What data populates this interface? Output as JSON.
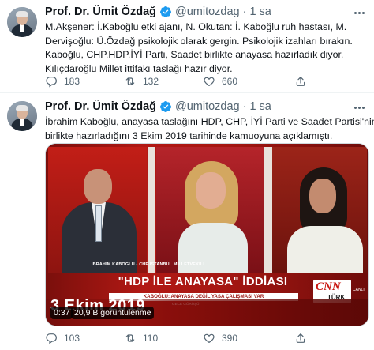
{
  "tweets": [
    {
      "author_name": "Prof. Dr. Ümit Özdağ",
      "handle": "@umitozdag",
      "separator": "·",
      "time": "1 sa",
      "text_lines": [
        "M.Akşener: İ.Kaboğlu etki ajanı, N. Okutan: İ. Kaboğlu ruh hastası, M.",
        "Dervişoğlu: Ü.Özdağ psikolojik olarak gergin. Psikolojik izahları bırakın.",
        "Kaboğlu, CHP,HDP,İYİ Parti, Saadet birlikte anayasa hazırladık diyor.",
        "Kılıçdaroğlu Millet ittifakı taslağı hazır diyor."
      ],
      "replies": "183",
      "retweets": "132",
      "likes": "660"
    },
    {
      "author_name": "Prof. Dr. Ümit Özdağ",
      "handle": "@umitozdag",
      "separator": "·",
      "time": "1 sa",
      "text_lines": [
        "İbrahim Kaboğlu, anayasa taslağını HDP, CHP, İYİ Parti ve Saadet Partisi'nin",
        "birlikte hazırladığını 3 Ekim 2019 tarihinde kamuoyuna açıklamıştı."
      ],
      "video": {
        "lower_third_name": "İBRAHİM KABOĞLU - CHP İSTANBUL MİLLETVEKİLİ",
        "headline": "\"HDP İLE ANAYASA\" İDDİASI",
        "subline": "KABOĞLU: ANAYASA DEĞİL YASA ÇALIŞMASI VAR",
        "subsub": "GECE GÖRÜŞÜ",
        "channel_logo": "CNN",
        "channel_sub": "TÜRK",
        "live_label": "CANLI",
        "date_overlay": "3 Ekim 2019",
        "duration": "0:37",
        "views": "20,9 B görüntülenme"
      },
      "replies": "103",
      "retweets": "110",
      "likes": "390"
    }
  ],
  "icons": {
    "verified": "verified-badge-icon",
    "reply": "reply-icon",
    "retweet": "retweet-icon",
    "like": "heart-icon",
    "share": "share-icon",
    "more": "more-icon"
  },
  "colors": {
    "verified": "#1d9bf0",
    "secondary_text": "#536471",
    "primary_text": "#0f1419",
    "divider": "#eff3f4"
  }
}
